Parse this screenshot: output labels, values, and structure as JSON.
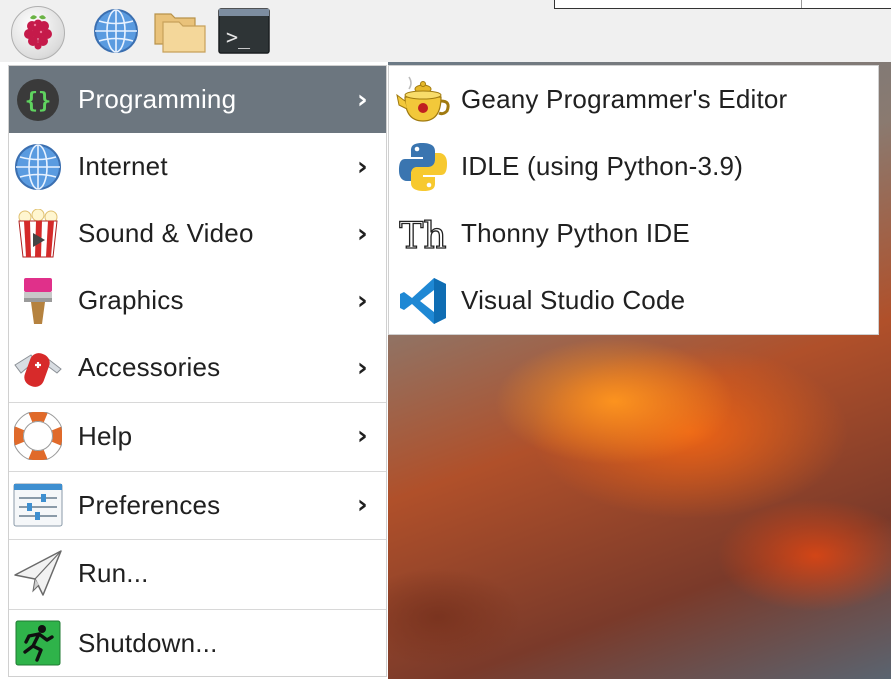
{
  "menu": {
    "items": [
      {
        "label": "Programming",
        "icon": "code-braces-icon",
        "has_submenu": true,
        "active": true
      },
      {
        "label": "Internet",
        "icon": "globe-icon",
        "has_submenu": true
      },
      {
        "label": "Sound & Video",
        "icon": "popcorn-icon",
        "has_submenu": true
      },
      {
        "label": "Graphics",
        "icon": "paintbrush-icon",
        "has_submenu": true
      },
      {
        "label": "Accessories",
        "icon": "pocketknife-icon",
        "has_submenu": true
      },
      {
        "label": "Help",
        "icon": "lifebuoy-icon",
        "has_submenu": true
      },
      {
        "label": "Preferences",
        "icon": "sliders-icon",
        "has_submenu": true
      },
      {
        "label": "Run...",
        "icon": "paper-plane-icon",
        "has_submenu": false
      },
      {
        "label": "Shutdown...",
        "icon": "running-man-icon",
        "has_submenu": false
      }
    ],
    "chevron": "›"
  },
  "submenu": {
    "items": [
      {
        "label": "Geany Programmer's Editor",
        "icon": "teapot-icon"
      },
      {
        "label": "IDLE (using Python-3.9)",
        "icon": "python-icon"
      },
      {
        "label": "Thonny Python IDE",
        "icon": "thonny-icon"
      },
      {
        "label": "Visual Studio Code",
        "icon": "vscode-icon"
      }
    ],
    "thonny_glyph": "Th"
  },
  "panel": {
    "buttons": [
      "raspberry-icon",
      "globe-icon",
      "folder-icon",
      "terminal-icon"
    ],
    "terminal_prompt": ">_"
  },
  "colors": {
    "active_item_bg": "#6c767f",
    "menu_bg": "#ffffff",
    "panel_bg": "#f0f0f0"
  }
}
